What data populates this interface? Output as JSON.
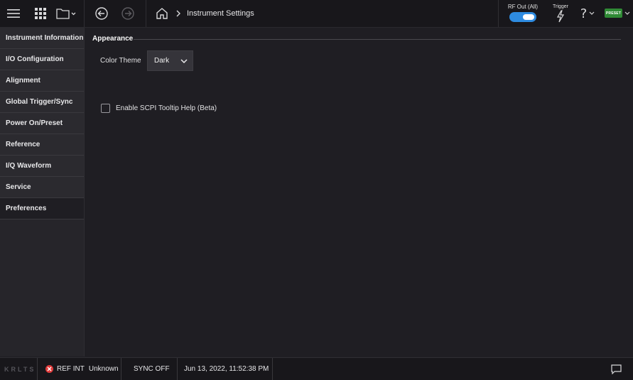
{
  "header": {
    "breadcrumb_title": "Instrument Settings",
    "rf_out_label": "RF Out (All)",
    "rf_out_state": "on",
    "trigger_label": "Trigger",
    "preset_label": "PRESET",
    "help_glyph": "?",
    "icons": [
      "menu-icon",
      "apps-grid-icon",
      "folder-icon",
      "back-arrow-icon",
      "forward-arrow-icon",
      "home-icon",
      "chevron-right-icon",
      "trigger-bolt-icon",
      "help-icon",
      "preset-icon"
    ]
  },
  "sidebar": {
    "items": [
      {
        "label": "Instrument Information",
        "active": false
      },
      {
        "label": "I/O Configuration",
        "active": false
      },
      {
        "label": "Alignment",
        "active": false
      },
      {
        "label": "Global Trigger/Sync",
        "active": false
      },
      {
        "label": "Power On/Preset",
        "active": false
      },
      {
        "label": "Reference",
        "active": false
      },
      {
        "label": "I/Q Waveform",
        "active": false
      },
      {
        "label": "Service",
        "active": false
      },
      {
        "label": "Preferences",
        "active": true
      }
    ]
  },
  "main": {
    "section_title": "Appearance",
    "color_theme_label": "Color Theme",
    "color_theme_value": "Dark",
    "scpi_tooltip_label": "Enable SCPI Tooltip Help (Beta)",
    "scpi_tooltip_checked": false
  },
  "statusbar": {
    "logo": "KRLTS",
    "ref_label": "REF INT",
    "ref_status": "Unknown",
    "sync_status": "SYNC OFF",
    "datetime": "Jun 13, 2022, 11:52:38 PM"
  },
  "colors": {
    "background": "#1f1e23",
    "topbar": "#18171b",
    "accent_toggle": "#2e8be0",
    "preset_green": "#2f8a35",
    "error_red": "#e03a3a"
  }
}
